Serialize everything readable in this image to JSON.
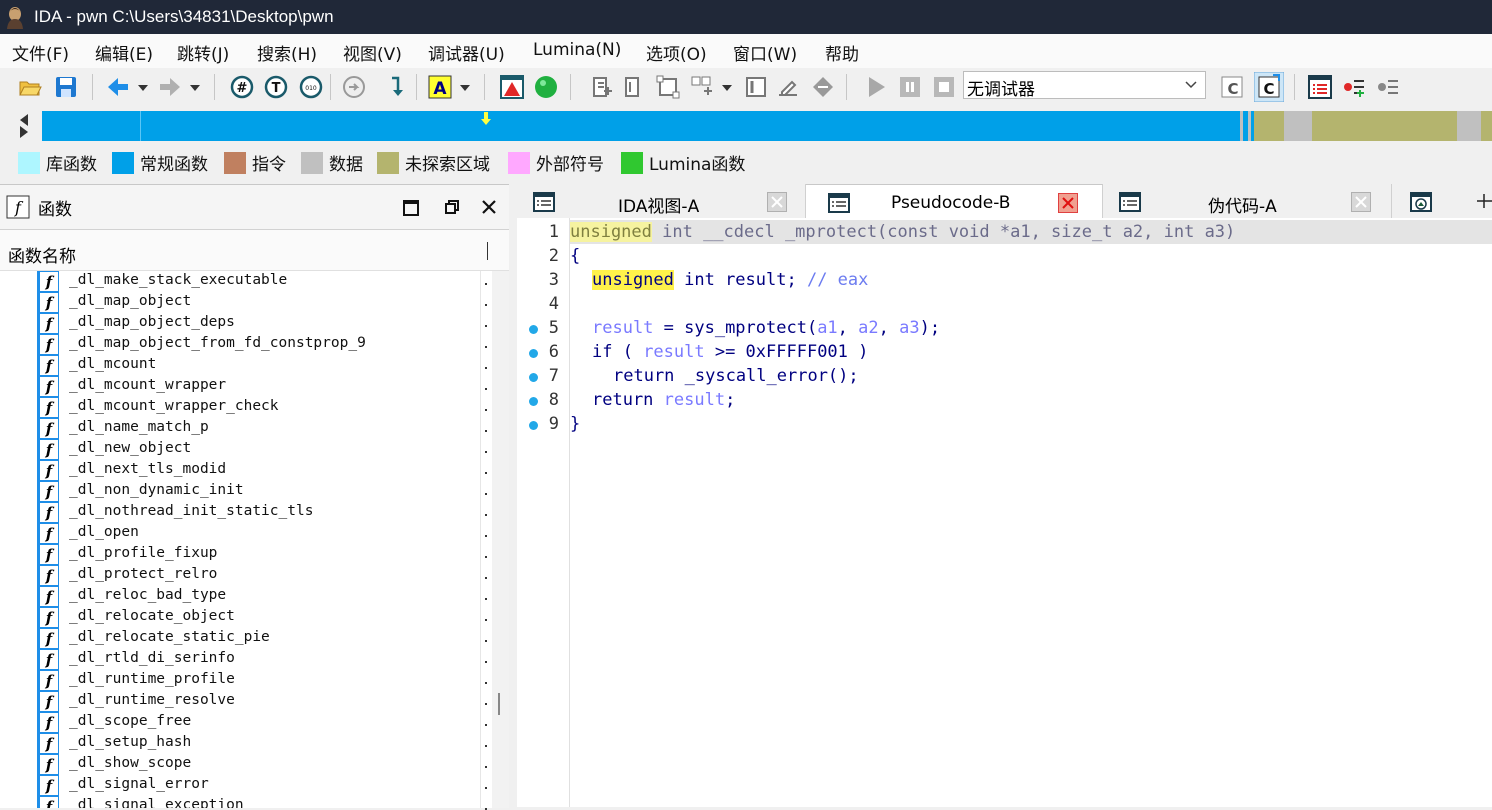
{
  "window": {
    "title": "IDA - pwn C:\\Users\\34831\\Desktop\\pwn"
  },
  "menu": [
    "文件(F)",
    "编辑(E)",
    "跳转(J)",
    "搜索(H)",
    "视图(V)",
    "调试器(U)",
    "Lumina(N)",
    "选项(O)",
    "窗口(W)",
    "帮助"
  ],
  "toolbar": {
    "debugger_select": "无调试器"
  },
  "legend": [
    {
      "label": "库函数",
      "color": "#aef6ff"
    },
    {
      "label": "常规函数",
      "color": "#00a0e8"
    },
    {
      "label": "指令",
      "color": "#c08060"
    },
    {
      "label": "数据",
      "color": "#c0c0c0"
    },
    {
      "label": "未探索区域",
      "color": "#b4b46e"
    },
    {
      "label": "外部符号",
      "color": "#ffa8ff"
    },
    {
      "label": "Lumina函数",
      "color": "#30c830"
    }
  ],
  "functions_panel": {
    "title": "函数",
    "column": "函数名称",
    "items": [
      "_dl_make_stack_executable",
      "_dl_map_object",
      "_dl_map_object_deps",
      "_dl_map_object_from_fd_constprop_9",
      "_dl_mcount",
      "_dl_mcount_wrapper",
      "_dl_mcount_wrapper_check",
      "_dl_name_match_p",
      "_dl_new_object",
      "_dl_next_tls_modid",
      "_dl_non_dynamic_init",
      "_dl_nothread_init_static_tls",
      "_dl_open",
      "_dl_profile_fixup",
      "_dl_protect_relro",
      "_dl_reloc_bad_type",
      "_dl_relocate_object",
      "_dl_relocate_static_pie",
      "_dl_rtld_di_serinfo",
      "_dl_runtime_profile",
      "_dl_runtime_resolve",
      "_dl_scope_free",
      "_dl_setup_hash",
      "_dl_show_scope",
      "_dl_signal_error",
      "_dl_signal_exception"
    ]
  },
  "tabs": [
    {
      "label": "IDA视图-A",
      "active": false
    },
    {
      "label": "Pseudocode-B",
      "active": true
    },
    {
      "label": "伪代码-A",
      "active": false
    }
  ],
  "code": {
    "line_numbers": [
      "1",
      "2",
      "3",
      "4",
      "5",
      "6",
      "7",
      "8",
      "9"
    ],
    "lines": {
      "l1": {
        "kw": "unsigned",
        "rest": " int __cdecl _mprotect(const void *a1, size_t a2, int a3)"
      },
      "l2": "{",
      "l3": {
        "kw": "unsigned",
        "decl": " int result; ",
        "comment": "// eax"
      },
      "l5": {
        "v1": "result",
        "t1": " = sys_mprotect(",
        "a1": "a1",
        "c1": ", ",
        "a2": "a2",
        "c2": ", ",
        "a3": "a3",
        "t2": ");"
      },
      "l6": {
        "t1": "if ( ",
        "v1": "result",
        "t2": " >= 0xFFFFF001 )"
      },
      "l7": "return _syscall_error();",
      "l8": {
        "t1": "return ",
        "v1": "result",
        "t2": ";"
      },
      "l9": "}"
    }
  }
}
